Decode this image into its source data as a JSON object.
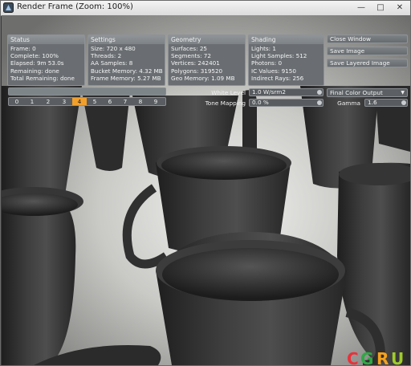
{
  "window": {
    "title": "Render Frame (Zoom: 100%)"
  },
  "panels": {
    "status": {
      "title": "Status",
      "lines": [
        "Frame: 0",
        "Complete: 100%",
        "Elapsed: 9m 53.0s",
        "Remaining: done",
        "Total Remaining: done"
      ]
    },
    "settings": {
      "title": "Settings",
      "lines": [
        "Size: 720 x 480",
        "Threads: 2",
        "AA Samples: 8",
        "Bucket Memory: 4.32 MB",
        "Frame Memory: 5.27 MB"
      ]
    },
    "geometry": {
      "title": "Geometry",
      "lines": [
        "Surfaces: 25",
        "Segments: 72",
        "Vertices: 242401",
        "Polygons: 319520",
        "Geo Memory: 1.09 MB"
      ]
    },
    "shading": {
      "title": "Shading",
      "lines": [
        "Lights: 1",
        "Light Samples: 512",
        "Photons: 0",
        "IC Values: 9150",
        "Indirect Rays: 256"
      ]
    }
  },
  "buttons": {
    "close_window": "Close Window",
    "save_image": "Save Image",
    "save_layered_image": "Save Layered Image"
  },
  "progress": {
    "fraction": 1.0
  },
  "frames": {
    "labels": [
      "0",
      "1",
      "2",
      "3",
      "4",
      "5",
      "6",
      "7",
      "8",
      "9"
    ],
    "active_index": 4
  },
  "controls": {
    "white_level_label": "White Level",
    "white_level_value": "1.0 W/srm2",
    "tone_mapping_label": "Tone Mapping",
    "tone_mapping_value": "0.0 %",
    "output_select": "Final Color Output",
    "gamma_label": "Gamma",
    "gamma_value": "1.6"
  },
  "logo": {
    "text": "CGRU"
  },
  "colors": {
    "accent_frame": "#f2a02c",
    "logo_c": "#e8323a",
    "logo_g": "#2ea844",
    "logo_r": "#f5a21c",
    "logo_u": "#9fcb2c"
  }
}
